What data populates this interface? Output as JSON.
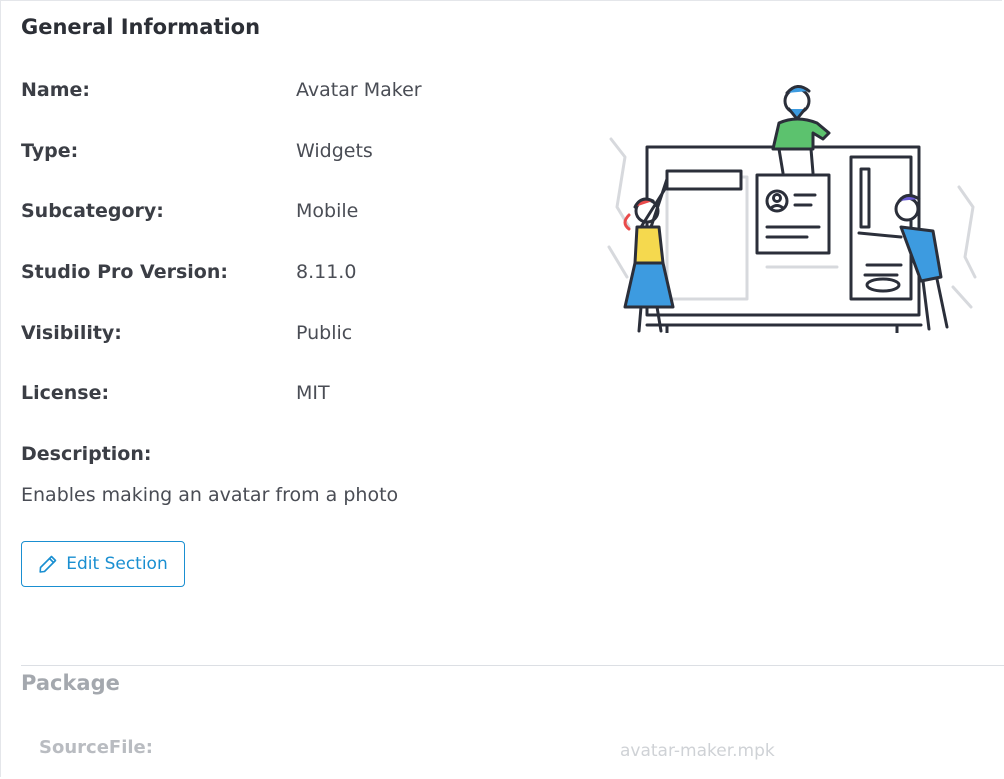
{
  "general": {
    "title": "General Information",
    "fields": [
      {
        "label": "Name:",
        "value": "Avatar Maker"
      },
      {
        "label": "Type:",
        "value": "Widgets"
      },
      {
        "label": "Subcategory:",
        "value": "Mobile"
      },
      {
        "label": "Studio Pro Version:",
        "value": "8.11.0"
      },
      {
        "label": "Visibility:",
        "value": "Public"
      },
      {
        "label": "License:",
        "value": "MIT"
      }
    ],
    "description_label": "Description:",
    "description": "Enables making an avatar from a photo",
    "edit_label": "Edit Section",
    "edit_icon": "pencil-icon",
    "accent_color": "#1a8fd1"
  },
  "package": {
    "title": "Package",
    "source_label": "SourceFile:",
    "source_value": "avatar-maker.mpk"
  },
  "illustration": {
    "name": "team-building-app-illustration",
    "colors": {
      "outline": "#2b2f3a",
      "green": "#5cc26e",
      "blue": "#3d9be0",
      "yellow": "#f5d94e",
      "red": "#e94b4b",
      "purple": "#6b5bd6",
      "gray": "#d7d9dd"
    }
  }
}
